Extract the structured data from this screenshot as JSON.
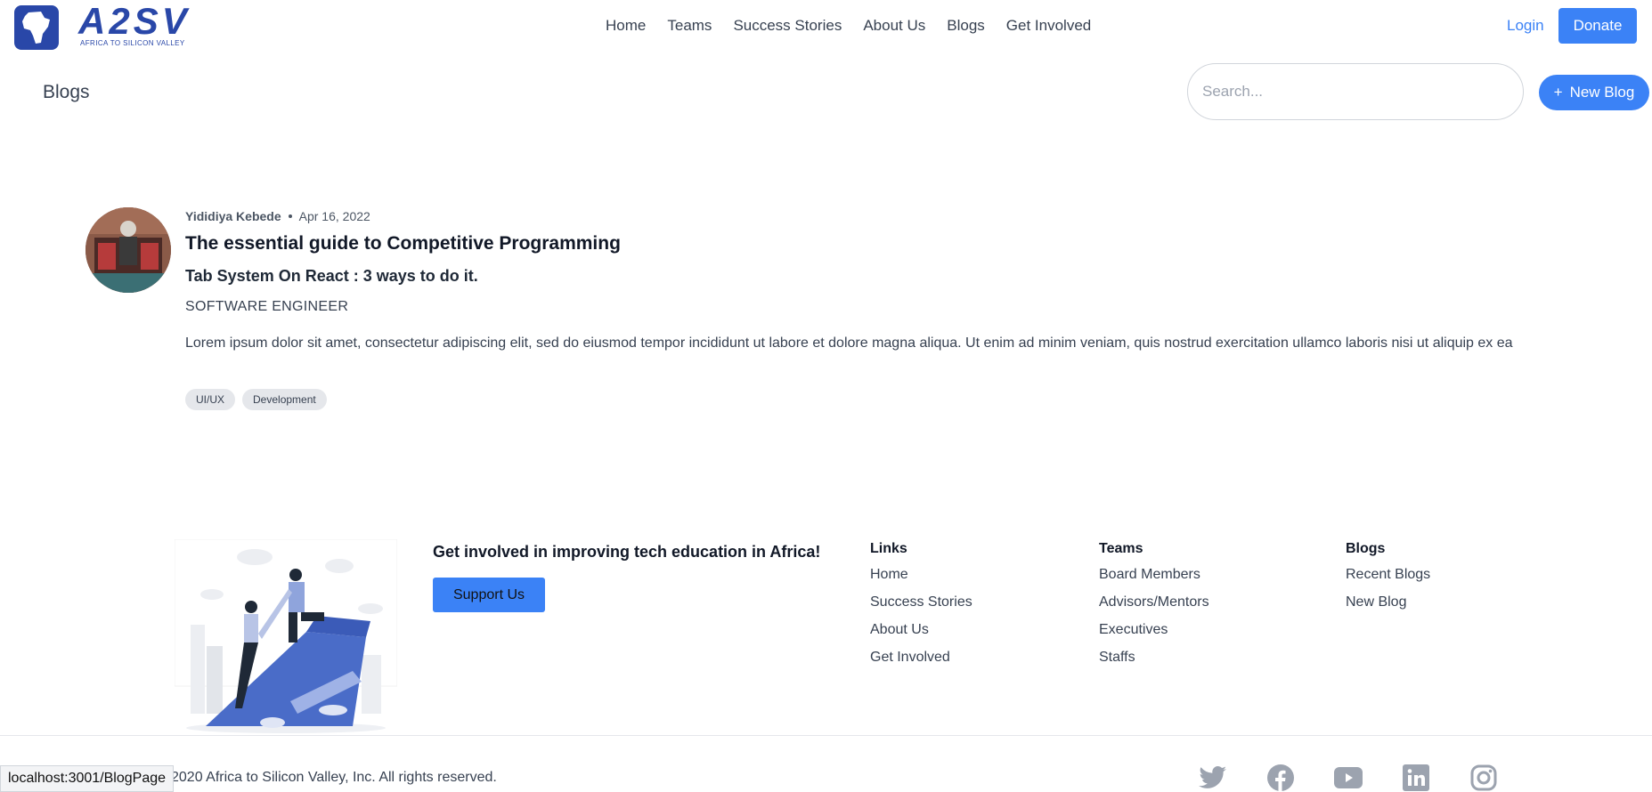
{
  "header": {
    "logo_text": "A2SV",
    "logo_tagline": "AFRICA TO SILICON VALLEY",
    "nav": [
      "Home",
      "Teams",
      "Success Stories",
      "About Us",
      "Blogs",
      "Get Involved"
    ],
    "login_label": "Login",
    "donate_label": "Donate"
  },
  "page": {
    "title": "Blogs",
    "search_placeholder": "Search...",
    "new_blog_label": "New Blog",
    "new_blog_icon": "plus-icon"
  },
  "blog": {
    "author": "Yididiya Kebede",
    "date": "Apr 16, 2022",
    "title": "The essential guide to Competitive Programming",
    "subtitle": "Tab System On React : 3 ways to do it.",
    "role": "SOFTWARE ENGINEER",
    "excerpt": "Lorem ipsum dolor sit amet, consectetur adipiscing elit, sed do eiusmod tempor incididunt ut labore et dolore magna aliqua. Ut enim ad minim veniam, quis nostrud exercitation ullamco laboris nisi ut aliquip ex ea",
    "tags": [
      "UI/UX",
      "Development"
    ]
  },
  "footer": {
    "cta_title": "Get involved in improving tech education in Africa!",
    "support_label": "Support Us",
    "columns": [
      {
        "heading": "Links",
        "links": [
          "Home",
          "Success Stories",
          "About Us",
          "Get Involved"
        ]
      },
      {
        "heading": "Teams",
        "links": [
          "Board Members",
          "Advisors/Mentors",
          "Executives",
          "Staffs"
        ]
      },
      {
        "heading": "Blogs",
        "links": [
          "Recent Blogs",
          "New Blog"
        ]
      }
    ],
    "copyright": "2020 Africa to Silicon Valley, Inc. All rights reserved.",
    "socials": [
      "twitter-icon",
      "facebook-icon",
      "youtube-icon",
      "linkedin-icon",
      "instagram-icon"
    ]
  },
  "status_bar": {
    "url": "localhost:3001/BlogPage"
  },
  "colors": {
    "accent": "#3b82f6",
    "brand": "#2947a8",
    "social_icon": "#9ca3af"
  }
}
